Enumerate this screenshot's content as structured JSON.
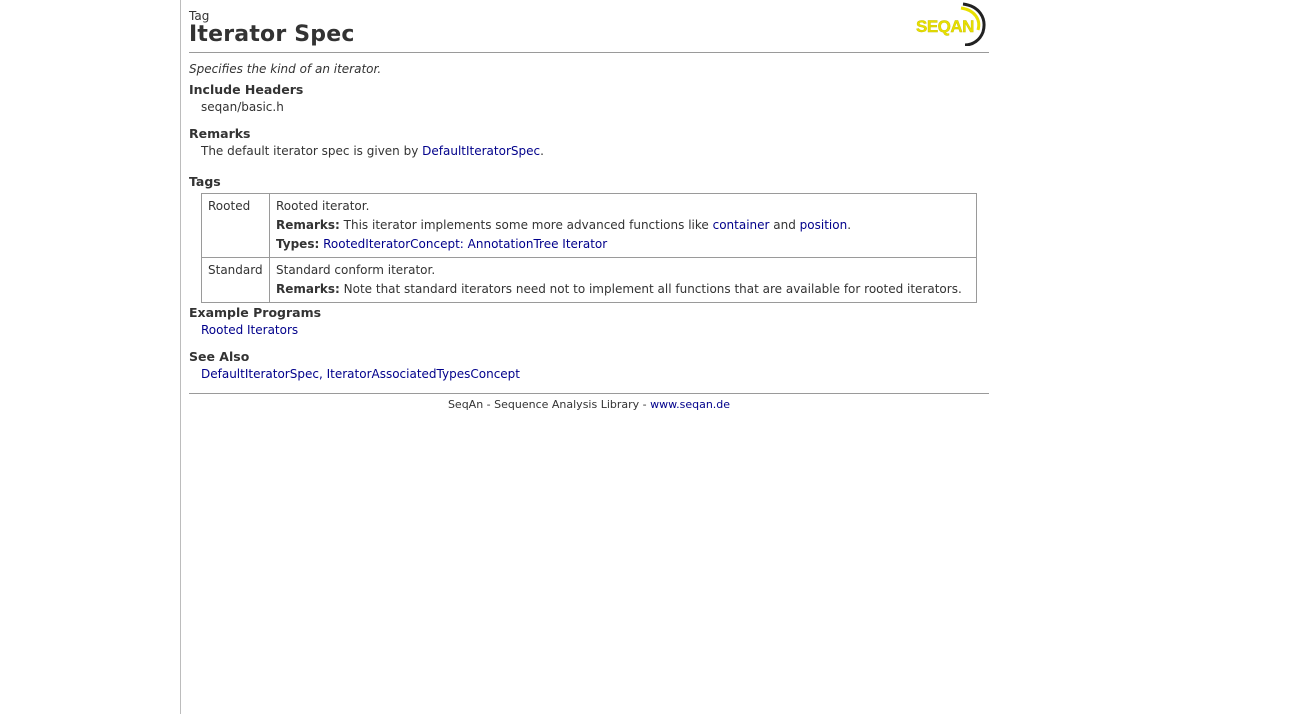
{
  "header": {
    "kind": "Tag",
    "title": "Iterator Spec",
    "logo_text": "SEQAN"
  },
  "summary": "Specifies the kind of an iterator.",
  "include_headers": {
    "heading": "Include Headers",
    "value": "seqan/basic.h"
  },
  "remarks": {
    "heading": "Remarks",
    "text_before": "The default iterator spec is given by ",
    "link": "DefaultIteratorSpec",
    "text_after": "."
  },
  "tags": {
    "heading": "Tags",
    "rows": [
      {
        "name": "Rooted",
        "description": "Rooted iterator.",
        "remarks_label": "Remarks:",
        "remarks_before": " This iterator implements some more advanced functions like ",
        "remarks_link1": "container",
        "remarks_mid": " and ",
        "remarks_link2": "position",
        "remarks_after": ".",
        "types_label": "Types:",
        "types_links": "RootedIteratorConcept: AnnotationTree Iterator"
      },
      {
        "name": "Standard",
        "description": "Standard conform iterator.",
        "remarks_label": "Remarks:",
        "remarks_text": " Note that standard iterators need not to implement all functions that are available for rooted iterators."
      }
    ]
  },
  "example_programs": {
    "heading": "Example Programs",
    "link": "Rooted Iterators"
  },
  "see_also": {
    "heading": "See Also",
    "link1": "DefaultIteratorSpec",
    "separator": ", ",
    "link2": "IteratorAssociatedTypesConcept"
  },
  "footer": {
    "text": "SeqAn - Sequence Analysis Library - ",
    "link": "www.seqan.de"
  },
  "colors": {
    "link": "#00008b",
    "logo_yellow": "#e8e000",
    "rule": "#9a9a9a"
  }
}
